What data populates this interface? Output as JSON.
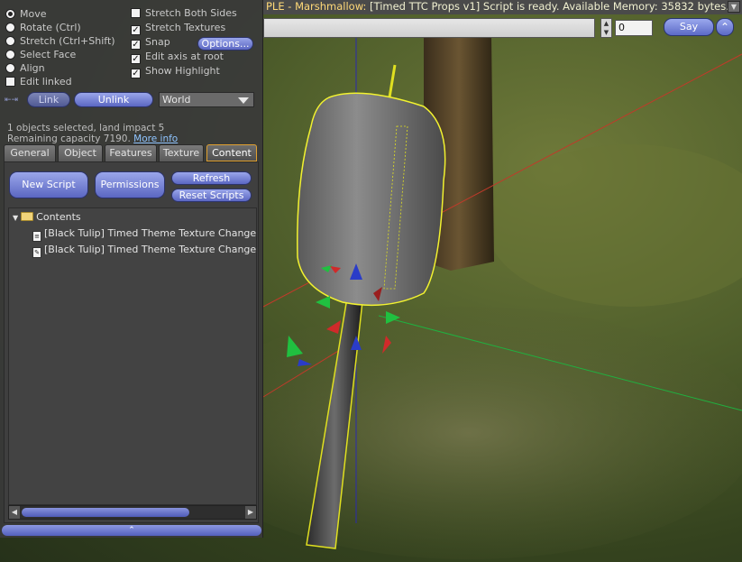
{
  "status_bar": {
    "object_name": "PLE - Marshmallow:",
    "message": "[Timed TTC Props v1] Script is ready. Available Memory: 35832 bytes.",
    "scroll_icon": "down-arrow-icon"
  },
  "chat": {
    "input_value": "",
    "channel_value": "0",
    "say_label": "Say",
    "expand_icon": "up-arrow-icon"
  },
  "build": {
    "modes": [
      {
        "label": "Move",
        "selected": true
      },
      {
        "label": "Rotate (Ctrl)",
        "selected": false
      },
      {
        "label": "Stretch (Ctrl+Shift)",
        "selected": false
      },
      {
        "label": "Select Face",
        "selected": false
      },
      {
        "label": "Align",
        "selected": false
      }
    ],
    "edit_linked": {
      "label": "Edit linked",
      "checked": false
    },
    "options": [
      {
        "label": "Stretch Both Sides",
        "checked": false
      },
      {
        "label": "Stretch Textures",
        "checked": true
      },
      {
        "label": "Snap",
        "checked": true
      },
      {
        "label": "Edit axis at root",
        "checked": true
      },
      {
        "label": "Show Highlight",
        "checked": true
      }
    ],
    "options_button": "Options...",
    "link_button": "Link",
    "unlink_button": "Unlink",
    "ruler_value": "World",
    "selection_info": "1 objects selected, land impact 5",
    "remaining_capacity": "Remaining capacity 7190.",
    "more_info_link": "More info",
    "tabs": [
      "General",
      "Object",
      "Features",
      "Texture",
      "Content"
    ],
    "active_tab": "Content",
    "content": {
      "new_script_button": "New Script",
      "permissions_button": "Permissions",
      "refresh_button": "Refresh",
      "reset_scripts_button": "Reset Scripts",
      "folder_label": "Contents",
      "items": [
        "[Black Tulip] Timed Theme Texture Change",
        "[Black Tulip] Timed Theme Texture Change"
      ]
    }
  }
}
